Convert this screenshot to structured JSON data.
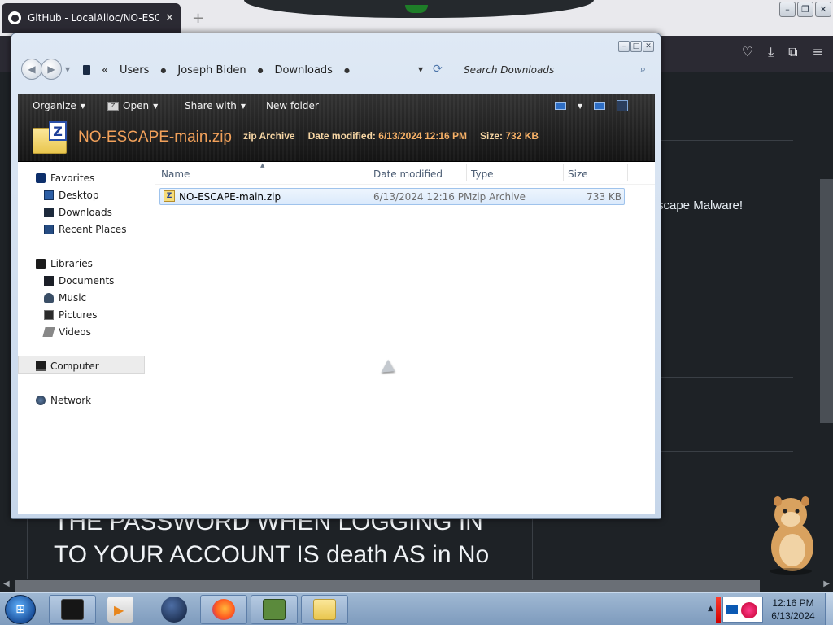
{
  "browser": {
    "tab_title": "GitHub - LocalAlloc/NO-ESCAPE",
    "tab_close": "✕",
    "new_tab": "+",
    "toolbar_icons": [
      "pocket-icon",
      "download-icon",
      "extensions-icon",
      "menu-icon"
    ]
  },
  "web": {
    "snippet": "scape Malware!",
    "big_text_line1": "THE PASSWORD WHEN LOGGING IN",
    "big_text_line2": "TO YOUR ACCOUNT IS death AS in No"
  },
  "explorer": {
    "breadcrumb": [
      "Users",
      "Joseph Biden",
      "Downloads"
    ],
    "breadcrumb_prefix": "«",
    "search_placeholder": "Search Downloads",
    "commands": {
      "organize": "Organize",
      "open": "Open",
      "share_with": "Share with",
      "new_folder": "New folder"
    },
    "details": {
      "name": "NO-ESCAPE-main.zip",
      "type": "zip Archive",
      "date_label": "Date modified:",
      "date_value": "6/13/2024 12:16 PM",
      "size_label": "Size:",
      "size_value": "732 KB"
    },
    "sidebar": {
      "favorites": "Favorites",
      "desktop": "Desktop",
      "downloads": "Downloads",
      "recent_places": "Recent Places",
      "libraries": "Libraries",
      "documents": "Documents",
      "music": "Music",
      "pictures": "Pictures",
      "videos": "Videos",
      "computer": "Computer",
      "network": "Network"
    },
    "columns": {
      "name": "Name",
      "date_modified": "Date modified",
      "type": "Type",
      "size": "Size"
    },
    "files": [
      {
        "name": "NO-ESCAPE-main.zip",
        "date_modified": "6/13/2024 12:16 PM",
        "type": "zip Archive",
        "size": "733 KB"
      }
    ]
  },
  "taskbar": {
    "time": "12:16 PM",
    "date": "6/13/2024",
    "apps": [
      "windows-explorer-dark",
      "media-player",
      "globe-app",
      "firefox",
      "box-game",
      "explorer-folder"
    ]
  },
  "colors": {
    "accent_orange": "#f2a15a",
    "selection_blue": "#dbeafc",
    "taskbar": "#9fb8d3"
  }
}
